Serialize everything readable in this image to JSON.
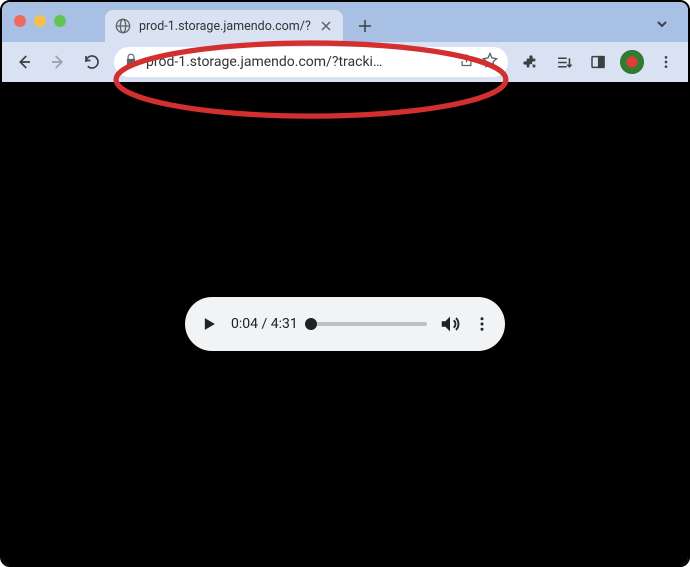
{
  "tab": {
    "title": "prod-1.storage.jamendo.com/?"
  },
  "toolbar": {
    "url": "prod-1.storage.jamendo.com/?tracki…"
  },
  "player": {
    "current_time": "0:04",
    "duration": "4:31",
    "separator": " / "
  }
}
